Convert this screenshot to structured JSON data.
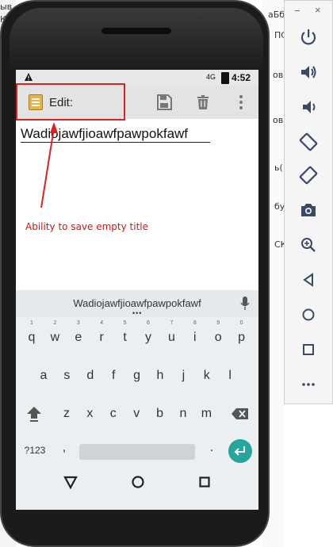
{
  "desktop": {
    "left_text": [
      "ыв",
      "К"
    ],
    "right_text": [
      "аБб",
      "ов",
      "ов"
    ],
    "extra_text": [
      "ПС",
      "ь(",
      "бу",
      "СК"
    ]
  },
  "status_bar": {
    "warning_icon": "warning-triangle",
    "signal_label": "4G",
    "time": "4:52"
  },
  "action_bar": {
    "title": "Edit:",
    "save_icon": "save-floppy-icon",
    "delete_icon": "trash-icon",
    "overflow_icon": "more-vertical-icon"
  },
  "note": {
    "title_value": "Wadiojawfjioawfpawpokfawf"
  },
  "annotation": {
    "text": "Ability to save empty title",
    "color": "#e02020"
  },
  "keyboard": {
    "suggestion": "Wadiojawfjioawfpawpokfawf",
    "row1": [
      "q",
      "w",
      "e",
      "r",
      "t",
      "y",
      "u",
      "i",
      "o",
      "p"
    ],
    "row1_hints": [
      "1",
      "2",
      "3",
      "4",
      "5",
      "6",
      "7",
      "8",
      "9",
      "0"
    ],
    "row2": [
      "a",
      "s",
      "d",
      "f",
      "g",
      "h",
      "j",
      "k",
      "l"
    ],
    "row3": [
      "z",
      "x",
      "c",
      "v",
      "b",
      "n",
      "m"
    ],
    "symbols_label": "?123",
    "comma": ",",
    "period": ".",
    "accent": "#26a69a"
  },
  "nav_bar": {
    "back_icon": "back-triangle-icon",
    "home_icon": "home-circle-icon",
    "recents_icon": "recents-square-icon"
  },
  "emulator_panel": {
    "minimize": "−",
    "close": "×",
    "buttons": [
      "power-icon",
      "volume-up-icon",
      "volume-down-icon",
      "rotate-left-icon",
      "rotate-right-icon",
      "camera-icon",
      "zoom-icon",
      "back-icon",
      "home-icon",
      "overview-icon",
      "more-icon"
    ]
  }
}
